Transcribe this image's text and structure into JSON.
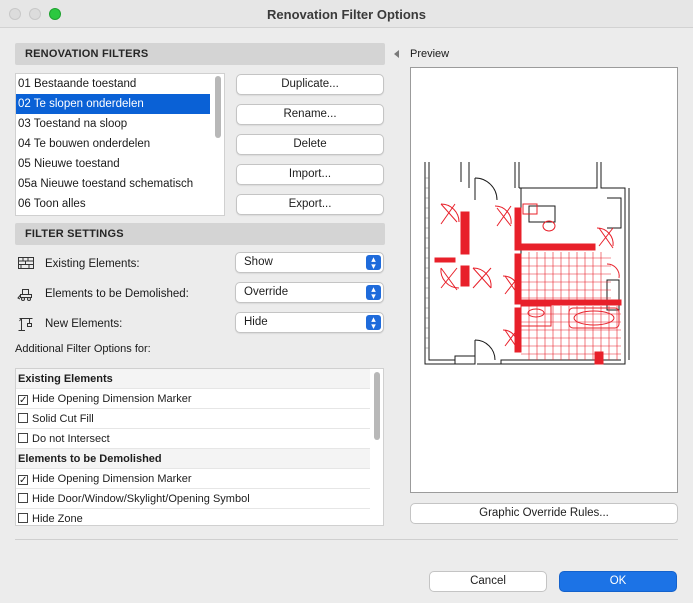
{
  "window": {
    "title": "Renovation Filter Options"
  },
  "renovation_filters": {
    "header": "RENOVATION FILTERS",
    "items": [
      {
        "label": "01 Bestaande toestand",
        "selected": false
      },
      {
        "label": "02 Te slopen onderdelen",
        "selected": true
      },
      {
        "label": "03 Toestand na sloop",
        "selected": false
      },
      {
        "label": "04 Te bouwen onderdelen",
        "selected": false
      },
      {
        "label": "05 Nieuwe toestand",
        "selected": false
      },
      {
        "label": "05a Nieuwe toestand schematisch",
        "selected": false
      },
      {
        "label": "06 Toon alles",
        "selected": false
      }
    ],
    "buttons": {
      "duplicate": "Duplicate...",
      "rename": "Rename...",
      "delete": "Delete",
      "import": "Import...",
      "export": "Export..."
    }
  },
  "filter_settings": {
    "header": "FILTER SETTINGS",
    "existing": {
      "label": "Existing Elements:",
      "value": "Show"
    },
    "demolished": {
      "label": "Elements to be Demolished:",
      "value": "Override"
    },
    "new": {
      "label": "New Elements:",
      "value": "Hide"
    }
  },
  "additional": {
    "label": "Additional Filter Options for:",
    "rows": [
      {
        "type": "group",
        "label": "Existing Elements"
      },
      {
        "type": "check",
        "label": "Hide Opening Dimension Marker",
        "checked": true
      },
      {
        "type": "check",
        "label": "Solid Cut Fill",
        "checked": false
      },
      {
        "type": "check",
        "label": "Do not Intersect",
        "checked": false
      },
      {
        "type": "group",
        "label": "Elements to be Demolished"
      },
      {
        "type": "check",
        "label": "Hide Opening Dimension Marker",
        "checked": true
      },
      {
        "type": "check",
        "label": "Hide Door/Window/Skylight/Opening Symbol",
        "checked": false
      },
      {
        "type": "check",
        "label": "Hide Zone",
        "checked": false
      }
    ]
  },
  "preview": {
    "label": "Preview",
    "graphic_override_button": "Graphic Override Rules..."
  },
  "footer": {
    "cancel": "Cancel",
    "ok": "OK"
  },
  "colors": {
    "accent": "#0a61d6",
    "ok_button": "#1c73e6",
    "demolish_red": "#e8202a"
  },
  "icons": {
    "existing": "wall-bricks-icon",
    "demolished": "bulldozer-icon",
    "new": "new-construction-icon",
    "popup": "updown-chevron-icon"
  }
}
